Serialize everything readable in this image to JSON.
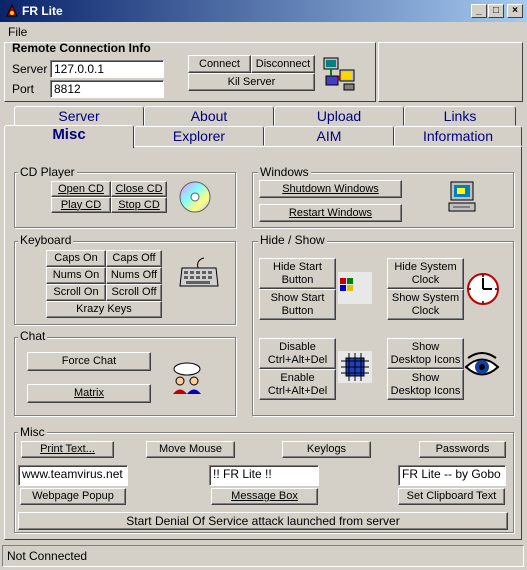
{
  "window": {
    "title": "FR Lite",
    "min": "_",
    "max": "□",
    "close": "×"
  },
  "menu": {
    "file": "File"
  },
  "remote": {
    "title": "Remote Connection Info",
    "server_label": "Server",
    "server_value": "127.0.0.1",
    "port_label": "Port",
    "port_value": "8812",
    "connect": "Connect",
    "disconnect": "Disconnect",
    "kill": "Kil Server"
  },
  "tabs": {
    "row1": [
      "Server",
      "About",
      "Upload",
      "Links"
    ],
    "row2": [
      "Misc",
      "Explorer",
      "AIM",
      "Information"
    ]
  },
  "cd": {
    "title": "CD Player",
    "open": "Open CD",
    "close": "Close CD",
    "play": "Play CD",
    "stop": "Stop CD"
  },
  "windows": {
    "title": "Windows",
    "shutdown": "Shutdown Windows",
    "restart": "Restart Windows"
  },
  "keyboard": {
    "title": "Keyboard",
    "caps_on": "Caps On",
    "caps_off": "Caps Off",
    "nums_on": "Nums On",
    "nums_off": "Nums Off",
    "scroll_on": "Scroll On",
    "scroll_off": "Scroll Off",
    "krazy": "Krazy Keys"
  },
  "hideshow": {
    "title": "Hide / Show",
    "hide_start_1": "Hide Start",
    "hide_start_2": "Button",
    "show_start_1": "Show Start",
    "show_start_2": "Button",
    "hide_clock_1": "Hide System",
    "hide_clock_2": "Clock",
    "show_clock_1": "Show System",
    "show_clock_2": "Clock",
    "disable_cad_1": "Disable",
    "disable_cad_2": "Ctrl+Alt+Del",
    "enable_cad_1": "Enable",
    "enable_cad_2": "Ctrl+Alt+Del",
    "show_icons_1": "Show",
    "show_icons_2": "Desktop Icons",
    "show_icons2_1": "Show",
    "show_icons2_2": "Desktop Icons"
  },
  "chat": {
    "title": "Chat",
    "force": "Force Chat",
    "matrix": "Matrix"
  },
  "misc": {
    "title": "Misc",
    "print": "Print Text...",
    "mouse": "Move Mouse",
    "keylogs": "Keylogs",
    "passwords": "Passwords",
    "url_value": "www.teamvirus.net",
    "msg_value": "!! FR Lite !!",
    "clip_value": "FR Lite -- by Gobo",
    "popup": "Webpage Popup",
    "msgbox": "Message Box",
    "clipboard": "Set Clipboard Text",
    "dos": "Start Denial Of Service attack launched from server"
  },
  "status": {
    "text": "Not Connected"
  }
}
